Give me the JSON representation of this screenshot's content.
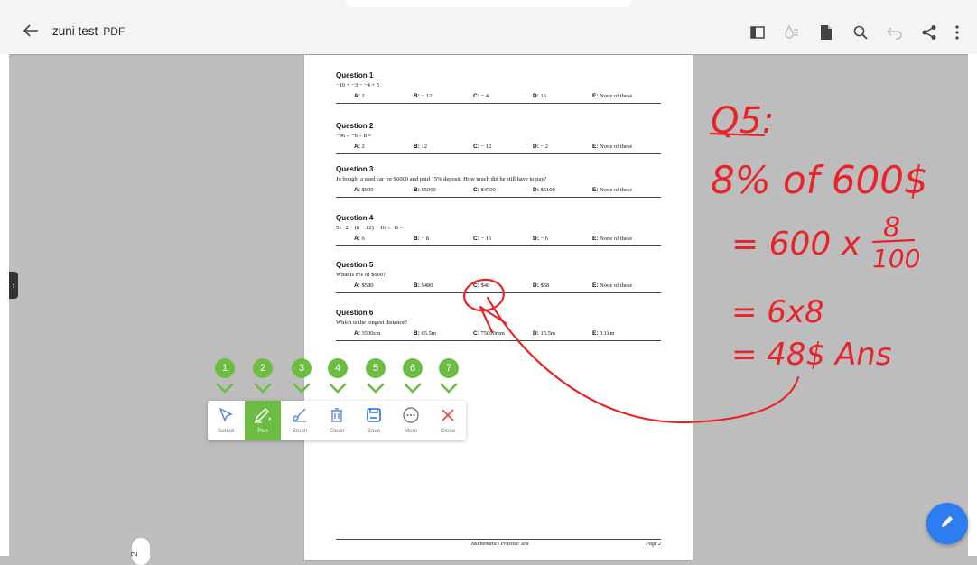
{
  "header": {
    "title": "zuni test",
    "file_type": "PDF",
    "icons": [
      "panel-icon",
      "ink-drop-icon",
      "document-icon",
      "search-icon",
      "undo-icon",
      "share-icon",
      "more-vert-icon"
    ]
  },
  "document": {
    "questions": [
      {
        "title": "Question 1",
        "prompt": "−10 + −3 − −4 + 5",
        "options": [
          {
            "key": "A:",
            "val": "2"
          },
          {
            "key": "B:",
            "val": "− 12"
          },
          {
            "key": "C:",
            "val": "− 4"
          },
          {
            "key": "D:",
            "val": "16"
          },
          {
            "key": "E:",
            "val": "None of these"
          }
        ]
      },
      {
        "title": "Question 2",
        "prompt": "−96 ÷ −6 ÷ 8 =",
        "options": [
          {
            "key": "A:",
            "val": "2"
          },
          {
            "key": "B:",
            "val": "12"
          },
          {
            "key": "C:",
            "val": "− 12"
          },
          {
            "key": "D:",
            "val": "− 2"
          },
          {
            "key": "E:",
            "val": "None of these"
          }
        ]
      },
      {
        "title": "Question 3",
        "prompt": "Jo bought a used car for $6000 and paid 15% deposit. How much did he still have to pay?",
        "options": [
          {
            "key": "A:",
            "val": "$900"
          },
          {
            "key": "B:",
            "val": "$5000"
          },
          {
            "key": "C:",
            "val": "$4500"
          },
          {
            "key": "D:",
            "val": "$5100"
          },
          {
            "key": "E:",
            "val": "None of these"
          }
        ]
      },
      {
        "title": "Question 4",
        "prompt": "5×−2 − (8 − 12) + 16 ÷ −8 =",
        "options": [
          {
            "key": "A:",
            "val": "6"
          },
          {
            "key": "B:",
            "val": "− 8"
          },
          {
            "key": "C:",
            "val": "− 16"
          },
          {
            "key": "D:",
            "val": "− 6"
          },
          {
            "key": "E:",
            "val": "None of these"
          }
        ]
      },
      {
        "title": "Question 5",
        "prompt": "What is 8% of $600?",
        "options": [
          {
            "key": "A:",
            "val": "$580"
          },
          {
            "key": "B:",
            "val": "$480"
          },
          {
            "key": "C:",
            "val": "$48"
          },
          {
            "key": "D:",
            "val": "$58"
          },
          {
            "key": "E:",
            "val": "None of these"
          }
        ]
      },
      {
        "title": "Question 6",
        "prompt": "Which is the longest distance?",
        "options": [
          {
            "key": "A:",
            "val": "3500cm"
          },
          {
            "key": "B:",
            "val": "65.5m"
          },
          {
            "key": "C:",
            "val": "75000mm"
          },
          {
            "key": "D:",
            "val": "15.5m"
          },
          {
            "key": "E:",
            "val": "0.1km"
          }
        ]
      }
    ],
    "footer_title": "Mathematics Practice Test",
    "footer_page": "Page 2"
  },
  "page_indicator": "2",
  "callouts": [
    "1",
    "2",
    "3",
    "4",
    "5",
    "6",
    "7"
  ],
  "toolbar": {
    "tools": [
      {
        "label": "Select",
        "icon": "cursor-icon",
        "active": false
      },
      {
        "label": "Pen",
        "icon": "pen-icon",
        "active": true
      },
      {
        "label": "Brush",
        "icon": "brush-icon",
        "active": false
      },
      {
        "label": "Clean",
        "icon": "trash-icon",
        "active": false
      },
      {
        "label": "Save",
        "icon": "save-icon",
        "active": false
      },
      {
        "label": "More",
        "icon": "more-icon",
        "active": false
      },
      {
        "label": "Close",
        "icon": "close-icon",
        "active": false
      }
    ]
  },
  "handwriting": {
    "line1": "Q5:",
    "line2": "8% of 600$",
    "line3": "= 600 x",
    "fraction_num": "8",
    "fraction_den": "100",
    "line4": "= 6x8",
    "line5": "= 48$ Ans"
  },
  "colors": {
    "accent": "#6dbd45",
    "ink": "#e8242b",
    "fab": "#2d7cf0",
    "topbar": "#f4f4f4",
    "canvas": "#bdbdbd"
  }
}
